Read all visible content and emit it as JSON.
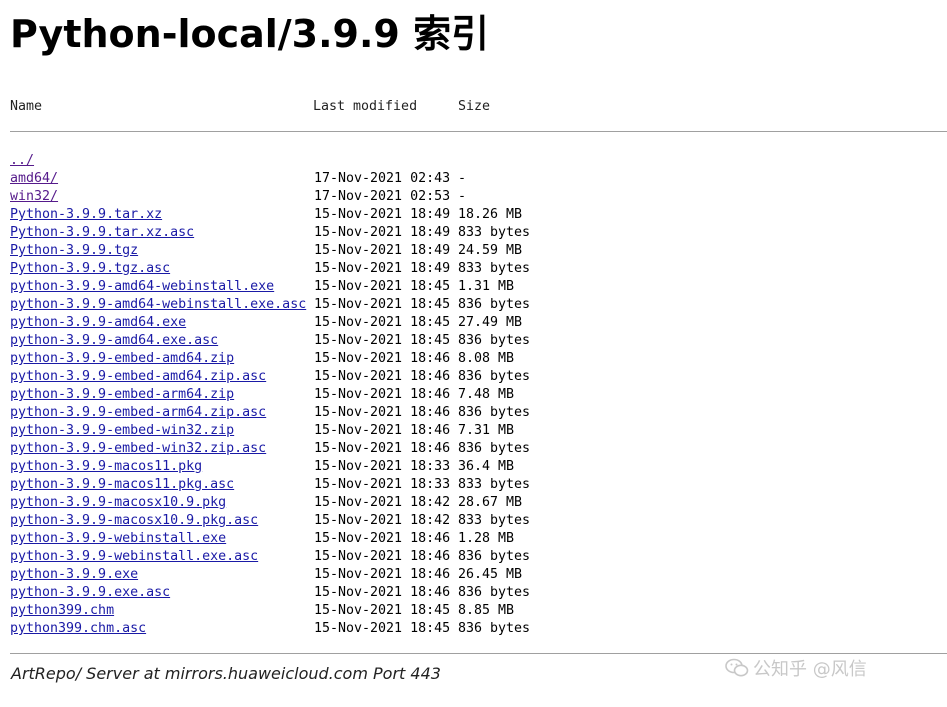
{
  "page": {
    "title": "Python-local/3.9.9 索引"
  },
  "table": {
    "headers": {
      "name": "Name",
      "modified": "Last modified",
      "size": "Size"
    },
    "rows": [
      {
        "name": "../",
        "modified": "",
        "size": "",
        "visited": true
      },
      {
        "name": "amd64/",
        "modified": "17-Nov-2021 02:43",
        "size": "-",
        "visited": true
      },
      {
        "name": "win32/",
        "modified": "17-Nov-2021 02:53",
        "size": "-",
        "visited": true
      },
      {
        "name": "Python-3.9.9.tar.xz",
        "modified": "15-Nov-2021 18:49",
        "size": "18.26 MB",
        "visited": false
      },
      {
        "name": "Python-3.9.9.tar.xz.asc",
        "modified": "15-Nov-2021 18:49",
        "size": "833 bytes",
        "visited": false
      },
      {
        "name": "Python-3.9.9.tgz",
        "modified": "15-Nov-2021 18:49",
        "size": "24.59 MB",
        "visited": false
      },
      {
        "name": "Python-3.9.9.tgz.asc",
        "modified": "15-Nov-2021 18:49",
        "size": "833 bytes",
        "visited": false
      },
      {
        "name": "python-3.9.9-amd64-webinstall.exe",
        "modified": "15-Nov-2021 18:45",
        "size": "1.31 MB",
        "visited": false
      },
      {
        "name": "python-3.9.9-amd64-webinstall.exe.asc",
        "modified": "15-Nov-2021 18:45",
        "size": "836 bytes",
        "visited": false
      },
      {
        "name": "python-3.9.9-amd64.exe",
        "modified": "15-Nov-2021 18:45",
        "size": "27.49 MB",
        "visited": false
      },
      {
        "name": "python-3.9.9-amd64.exe.asc",
        "modified": "15-Nov-2021 18:45",
        "size": "836 bytes",
        "visited": false
      },
      {
        "name": "python-3.9.9-embed-amd64.zip",
        "modified": "15-Nov-2021 18:46",
        "size": "8.08 MB",
        "visited": false
      },
      {
        "name": "python-3.9.9-embed-amd64.zip.asc",
        "modified": "15-Nov-2021 18:46",
        "size": "836 bytes",
        "visited": false
      },
      {
        "name": "python-3.9.9-embed-arm64.zip",
        "modified": "15-Nov-2021 18:46",
        "size": "7.48 MB",
        "visited": false
      },
      {
        "name": "python-3.9.9-embed-arm64.zip.asc",
        "modified": "15-Nov-2021 18:46",
        "size": "836 bytes",
        "visited": false
      },
      {
        "name": "python-3.9.9-embed-win32.zip",
        "modified": "15-Nov-2021 18:46",
        "size": "7.31 MB",
        "visited": false
      },
      {
        "name": "python-3.9.9-embed-win32.zip.asc",
        "modified": "15-Nov-2021 18:46",
        "size": "836 bytes",
        "visited": false
      },
      {
        "name": "python-3.9.9-macos11.pkg",
        "modified": "15-Nov-2021 18:33",
        "size": "36.4 MB",
        "visited": false
      },
      {
        "name": "python-3.9.9-macos11.pkg.asc",
        "modified": "15-Nov-2021 18:33",
        "size": "833 bytes",
        "visited": false
      },
      {
        "name": "python-3.9.9-macosx10.9.pkg",
        "modified": "15-Nov-2021 18:42",
        "size": "28.67 MB",
        "visited": false
      },
      {
        "name": "python-3.9.9-macosx10.9.pkg.asc",
        "modified": "15-Nov-2021 18:42",
        "size": "833 bytes",
        "visited": false
      },
      {
        "name": "python-3.9.9-webinstall.exe",
        "modified": "15-Nov-2021 18:46",
        "size": "1.28 MB",
        "visited": false
      },
      {
        "name": "python-3.9.9-webinstall.exe.asc",
        "modified": "15-Nov-2021 18:46",
        "size": "836 bytes",
        "visited": false
      },
      {
        "name": "python-3.9.9.exe",
        "modified": "15-Nov-2021 18:46",
        "size": "26.45 MB",
        "visited": false
      },
      {
        "name": "python-3.9.9.exe.asc",
        "modified": "15-Nov-2021 18:46",
        "size": "836 bytes",
        "visited": false
      },
      {
        "name": "python399.chm",
        "modified": "15-Nov-2021 18:45",
        "size": "8.85 MB",
        "visited": false
      },
      {
        "name": "python399.chm.asc",
        "modified": "15-Nov-2021 18:45",
        "size": "836 bytes",
        "visited": false
      }
    ]
  },
  "footer": {
    "text": "ArtRepo/ Server at mirrors.huaweicloud.com Port 443"
  },
  "watermark": {
    "text": "公知乎 @风信",
    "icon": "wechat-icon"
  },
  "colors": {
    "link": "#1a1aa6",
    "visited_link": "#551a8b",
    "separator": "#a0a0a0"
  }
}
